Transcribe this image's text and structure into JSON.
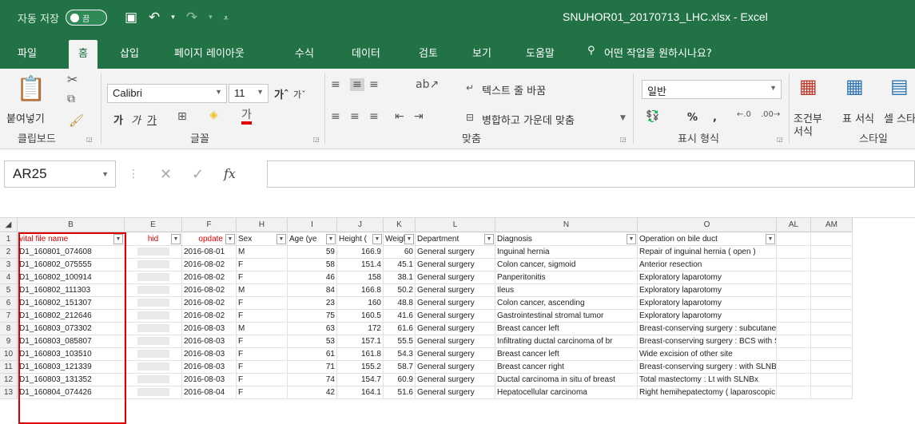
{
  "titlebar": {
    "autosave_label": "자동 저장",
    "toggle_label": "끔",
    "filename": "SNUHOR01_20170713_LHC.xlsx - Excel"
  },
  "tabs": [
    "파일",
    "홈",
    "삽입",
    "페이지 레이아웃",
    "수식",
    "데이터",
    "검토",
    "보기",
    "도움말"
  ],
  "tell_me": "어떤 작업을 원하시나요?",
  "ribbon": {
    "clipboard": {
      "paste": "붙여넣기",
      "group": "클립보드"
    },
    "font": {
      "name": "Calibri",
      "size": "11",
      "group": "글꼴",
      "bold": "가",
      "italic": "가",
      "underline": "가"
    },
    "alignment": {
      "wrap": "텍스트 줄 바꿈",
      "merge": "병합하고 가운데 맞춤",
      "group": "맞춤"
    },
    "number": {
      "format": "일반",
      "group": "표시 형식",
      "percent": "%",
      "comma": ","
    },
    "styles": {
      "conditional": "조건부 서식",
      "table": "표 서식",
      "cell": "셀 스타일",
      "group": "스타일"
    }
  },
  "formula": {
    "namebox": "AR25",
    "fx": "fx"
  },
  "columns": [
    {
      "id": "B",
      "w": 134
    },
    {
      "id": "E",
      "w": 72
    },
    {
      "id": "F",
      "w": 68
    },
    {
      "id": "H",
      "w": 64
    },
    {
      "id": "I",
      "w": 62
    },
    {
      "id": "J",
      "w": 58
    },
    {
      "id": "K",
      "w": 40
    },
    {
      "id": "L",
      "w": 100
    },
    {
      "id": "N",
      "w": 178
    },
    {
      "id": "O",
      "w": 174
    },
    {
      "id": "AL",
      "w": 43
    },
    {
      "id": "AM",
      "w": 52
    }
  ],
  "headers": [
    "vital file name",
    "hid",
    "opdate",
    "Sex",
    "Age (ye",
    "Height (",
    "Weight",
    "Department",
    "Diagnosis",
    "Operation on bile duct"
  ],
  "rows": [
    [
      "D1_160801_074608",
      "",
      "2016-08-01",
      "M",
      "59",
      "166.9",
      "60",
      "General surgery",
      "Inguinal hernia",
      "Repair of inguinal hernia ( open )"
    ],
    [
      "D1_160802_075555",
      "",
      "2016-08-02",
      "F",
      "58",
      "151.4",
      "45.1",
      "General surgery",
      "Colon cancer, sigmoid",
      "Anterior resection"
    ],
    [
      "D1_160802_100914",
      "",
      "2016-08-02",
      "F",
      "46",
      "158",
      "38.1",
      "General surgery",
      "Panperitonitis",
      "Exploratory laparotomy"
    ],
    [
      "D1_160802_111303",
      "",
      "2016-08-02",
      "M",
      "84",
      "166.8",
      "50.2",
      "General surgery",
      "Ileus",
      "Exploratory laparotomy"
    ],
    [
      "D1_160802_151307",
      "",
      "2016-08-02",
      "F",
      "23",
      "160",
      "48.8",
      "General surgery",
      "Colon cancer, ascending",
      "Exploratory laparotomy"
    ],
    [
      "D1_160802_212646",
      "",
      "2016-08-02",
      "F",
      "75",
      "160.5",
      "41.6",
      "General surgery",
      "Gastrointestinal stromal tumor",
      "Exploratory laparotomy"
    ],
    [
      "D1_160803_073302",
      "",
      "2016-08-03",
      "M",
      "63",
      "172",
      "61.6",
      "General surgery",
      "Breast cancer left",
      "Breast-conserving surgery : subcutaneous mastectomy wi"
    ],
    [
      "D1_160803_085807",
      "",
      "2016-08-03",
      "F",
      "53",
      "157.1",
      "55.5",
      "General surgery",
      "Infiltrating ductal carcinoma of br",
      "Breast-conserving surgery : BCS with SLNBx. Rt."
    ],
    [
      "D1_160803_103510",
      "",
      "2016-08-03",
      "F",
      "61",
      "161.8",
      "54.3",
      "General surgery",
      "Breast cancer left",
      "Wide excision of other site"
    ],
    [
      "D1_160803_121339",
      "",
      "2016-08-03",
      "F",
      "71",
      "155.2",
      "58.7",
      "General surgery",
      "Breast cancer right",
      "Breast-conserving surgery : with SLNBx,Rt."
    ],
    [
      "D1_160803_131352",
      "",
      "2016-08-03",
      "F",
      "74",
      "154.7",
      "60.9",
      "General surgery",
      "Ductal carcinoma in situ of breast",
      "Total mastectomy : Lt with SLNBx"
    ],
    [
      "D1_160804_074426",
      "",
      "2016-08-04",
      "F",
      "42",
      "164.1",
      "51.6",
      "General surgery",
      "Hepatocellular carcinoma",
      "Right hemihepatectomy ( laparoscopic )"
    ]
  ],
  "row_numbers": [
    "1",
    "2",
    "3",
    "4",
    "5",
    "6",
    "7",
    "8",
    "9",
    "10",
    "11",
    "12",
    "13"
  ]
}
